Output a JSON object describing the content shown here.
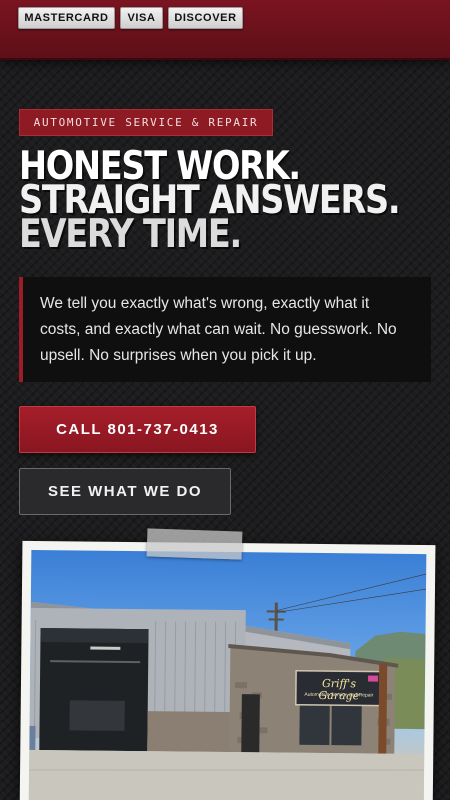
{
  "payment_cards": [
    "MASTERCARD",
    "VISA",
    "DISCOVER"
  ],
  "hero": {
    "eyebrow": "AUTOMOTIVE SERVICE & REPAIR",
    "headline_lines": [
      "HONEST WORK.",
      "STRAIGHT ANSWERS.",
      "EVERY TIME."
    ],
    "callout": "We tell you exactly what's wrong, exactly what it costs, and exactly what can wait. No guesswork. No upsell. No surprises when you pick it up."
  },
  "buttons": {
    "call": "CALL 801-737-0413",
    "services": "SEE WHAT WE DO"
  },
  "photo": {
    "sign_name": "Griff's Garage",
    "sign_subtitle": "Automotive Service and Repair"
  },
  "colors": {
    "brand_red": "#8e1a24",
    "background": "#1d1d1f"
  }
}
